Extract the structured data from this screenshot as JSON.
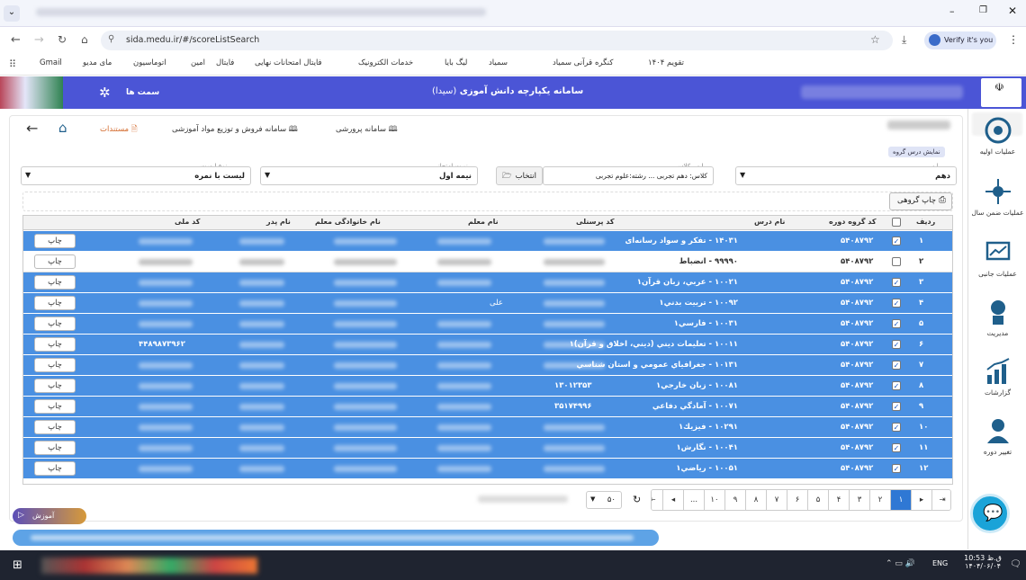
{
  "browser": {
    "url": "sida.medu.ir/#/scoreListSearch",
    "profile_label": "Verify it's you",
    "bookmarks": [
      "تقویم ۱۴۰۴",
      "کنگره قرآنی سمیاد",
      "سمیاد",
      "لیگ بایا",
      "خدمات الکترونیک",
      "فایتال امتحانات نهایی",
      "فایتال",
      "امین",
      "اتوماسیون",
      "مای مدیو",
      "Gmail"
    ]
  },
  "app": {
    "title": "سامانه یکپارچه دانش آموزی",
    "title_abbr": "(سیدا)",
    "samt_label": "سمت ها"
  },
  "toplinks": {
    "documents": "مستندات",
    "sales": "سامانه فروش و توزیع مواد آموزشی",
    "parvaresh": "سامانه پرورشی"
  },
  "breadcrumb_tag": "نمایش درس گروه",
  "filters": {
    "grade_label": "پایه",
    "grade_value": "دهم",
    "class_label": "پایه ، کلاس",
    "class_value": "کلاس: دهم تجربی ... رشته:علوم تجربی",
    "select_btn": "انتخاب",
    "exam_label": "نوبت امتحانی",
    "exam_value": "نیمه اول",
    "list_label": "نوع لیست",
    "list_value": "لیست با نمره"
  },
  "group_print_btn": "چاپ گروهی",
  "columns": {
    "row": "ردیف",
    "group_code": "کد گروه دوره",
    "course": "نام درس",
    "personnel": "کد پرسنلی",
    "teacher": "نام معلم",
    "teacher_family": "نام خانوادگی معلم",
    "father": "نام پدر",
    "national": "کد ملی"
  },
  "print_label": "چاپ",
  "rows": [
    {
      "n": "۱",
      "code": "۵۴۰۸۷۹۲",
      "course": "۱۴۰۳۱ - تفکر و سواد رسانه‌ای",
      "checked": true
    },
    {
      "n": "۲",
      "code": "۵۴۰۸۷۹۲",
      "course": "۹۹۹۹۰ - انضباط",
      "checked": false
    },
    {
      "n": "۳",
      "code": "۵۴۰۸۷۹۲",
      "course": "۱۰۰۲۱ - عربي، زبان قرآن۱",
      "checked": true
    },
    {
      "n": "۴",
      "code": "۵۴۰۸۷۹۲",
      "course": "۱۰۰۹۲ - تربيت بدني۱",
      "checked": true,
      "teacher": "علی"
    },
    {
      "n": "۵",
      "code": "۵۴۰۸۷۹۲",
      "course": "۱۰۰۳۱ - فارسي۱",
      "checked": true
    },
    {
      "n": "۶",
      "code": "۵۴۰۸۷۹۲",
      "course": "۱۰۰۱۱ - تعليمات ديني (ديني، اخلاق و قرآن)۱",
      "checked": true,
      "national": "۴۴۸۹۸۷۳۹۶۲"
    },
    {
      "n": "۷",
      "code": "۵۴۰۸۷۹۲",
      "course": "۱۰۱۳۱ - جغرافياي عمومي و استان شناسي",
      "checked": true
    },
    {
      "n": "۸",
      "code": "۵۴۰۸۷۹۲",
      "course": "۱۰۰۸۱ - زبان خارجي۱",
      "checked": true,
      "personnel": "۱۳۰۱۲۳۵۳"
    },
    {
      "n": "۹",
      "code": "۵۴۰۸۷۹۲",
      "course": "۱۰۰۷۱ - آمادگي دفاعي",
      "checked": true,
      "personnel": "۳۵۱۷۴۹۹۶"
    },
    {
      "n": "۱۰",
      "code": "۵۴۰۸۷۹۲",
      "course": "۱۰۲۹۱ - فيزيك۱",
      "checked": true
    },
    {
      "n": "۱۱",
      "code": "۵۴۰۸۷۹۲",
      "course": "۱۰۰۴۱ - نگارش۱",
      "checked": true
    },
    {
      "n": "۱۲",
      "code": "۵۴۰۸۷۹۲",
      "course": "۱۰۰۵۱ - رياضي۱",
      "checked": true
    }
  ],
  "pagination": {
    "pages": [
      "۱",
      "۲",
      "۳",
      "۴",
      "۵",
      "۶",
      "۷",
      "۸",
      "۹",
      "۱۰",
      "..."
    ],
    "page_size": "۵۰"
  },
  "rightnav": [
    "عملیات اولیه",
    "عملیات ضمن سال",
    "عملیات جانبی",
    "مدیریت",
    "گزارشات",
    "تغییر دوره"
  ],
  "promo": "آموزش",
  "taskbar": {
    "time": "10:53 ق.ظ",
    "date": "۱۴۰۴/۰۶/۰۴",
    "lang": "ENG"
  },
  "colors": {
    "header": "#4b55d6",
    "row": "#4a90e2",
    "active_page": "#2f78d4"
  }
}
